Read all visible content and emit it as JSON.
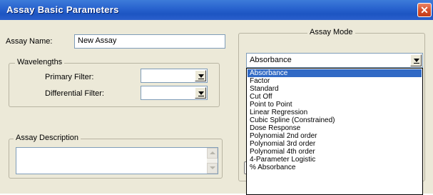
{
  "window": {
    "title": "Assay Basic Parameters",
    "close_label": "✕"
  },
  "form": {
    "assay_name_label": "Assay Name:",
    "assay_name_value": "New Assay",
    "wavelengths": {
      "legend": "Wavelengths",
      "primary_label": "Primary Filter:",
      "primary_value": "",
      "differential_label": "Differential Filter:",
      "differential_value": ""
    },
    "description": {
      "legend": "Assay Description",
      "value": ""
    }
  },
  "assay_mode": {
    "legend": "Assay Mode",
    "selected": "Absorbance",
    "options": [
      "Absorbance",
      "Factor",
      "Standard",
      "Cut Off",
      "Point to Point",
      "Linear Regression",
      "Cubic Spline (Constrained)",
      "Dose Response",
      "Polynomial 2nd order",
      "Polynomial 3rd order",
      "Polynomial 4th order",
      "4-Parameter Logistic",
      "% Absorbance"
    ]
  },
  "colors": {
    "title_bar": "#2a64cf",
    "close_button": "#d5502d",
    "dialog_bg": "#ece9d8",
    "selection": "#316ac5"
  },
  "icons": {
    "close": "close-icon",
    "dropdown": "chevron-down-icon"
  }
}
